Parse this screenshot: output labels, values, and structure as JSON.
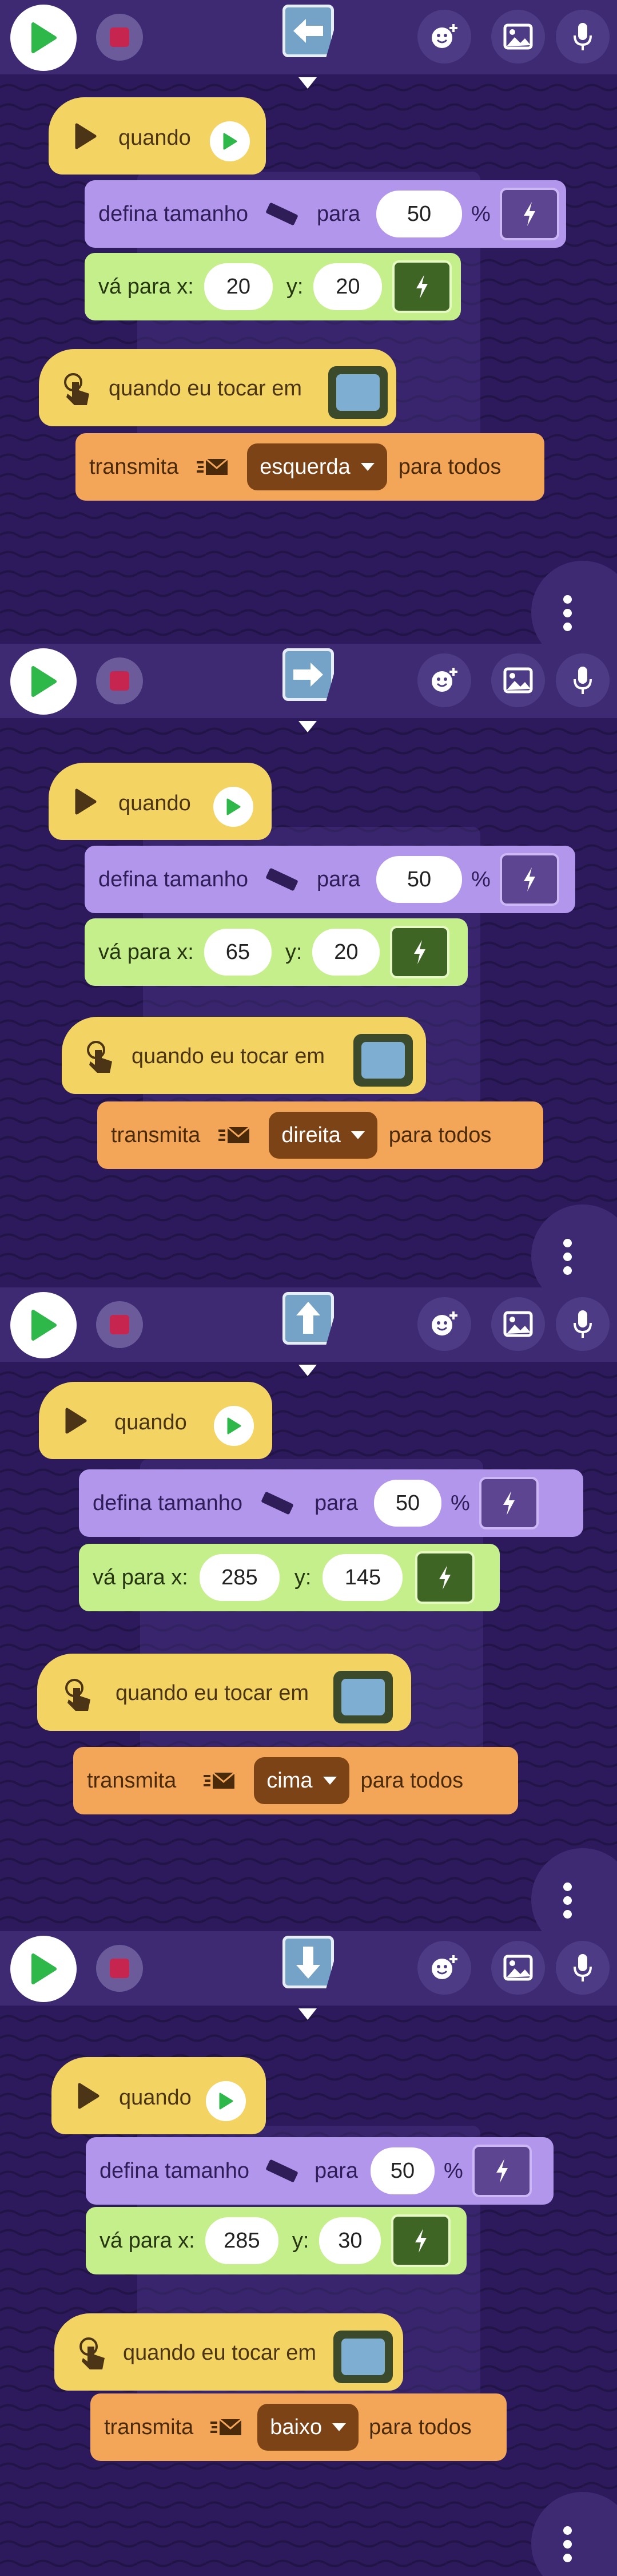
{
  "toolbar": {
    "go_icon": "green-flag-play",
    "stop_icon": "stop-square",
    "sprite_icon": "arrow-sprite",
    "character_icon": "add-character-icon",
    "background_icon": "image-icon",
    "sound_icon": "microphone-icon"
  },
  "colors": {
    "event": "#f3d463",
    "looks": "#b196ec",
    "motion": "#c5ef8a",
    "message": "#f4a658"
  },
  "panels": [
    {
      "sprite": "left-arrow",
      "when_label": "quando",
      "size_label": "defina tamanho",
      "para_label": "para",
      "size_value": "50",
      "percent": "%",
      "goto_label": "vá para x:",
      "x_value": "20",
      "y_label": "y:",
      "y_value": "20",
      "tap_label": "quando eu tocar em",
      "broadcast_label": "transmita",
      "message": "esquerda",
      "to_all": "para todos"
    },
    {
      "sprite": "right-arrow",
      "when_label": "quando",
      "size_label": "defina tamanho",
      "para_label": "para",
      "size_value": "50",
      "percent": "%",
      "goto_label": "vá para x:",
      "x_value": "65",
      "y_label": "y:",
      "y_value": "20",
      "tap_label": "quando eu tocar em",
      "broadcast_label": "transmita",
      "message": "direita",
      "to_all": "para todos"
    },
    {
      "sprite": "up-arrow",
      "when_label": "quando",
      "size_label": "defina tamanho",
      "para_label": "para",
      "size_value": "50",
      "percent": "%",
      "goto_label": "vá para x:",
      "x_value": "285",
      "y_label": "y:",
      "y_value": "145",
      "tap_label": "quando eu tocar em",
      "broadcast_label": "transmita",
      "message": "cima",
      "to_all": "para todos"
    },
    {
      "sprite": "down-arrow",
      "when_label": "quando",
      "size_label": "defina tamanho",
      "para_label": "para",
      "size_value": "50",
      "percent": "%",
      "goto_label": "vá para x:",
      "x_value": "285",
      "y_label": "y:",
      "y_value": "30",
      "tap_label": "quando eu tocar em",
      "broadcast_label": "transmita",
      "message": "baixo",
      "to_all": "para todos"
    }
  ]
}
